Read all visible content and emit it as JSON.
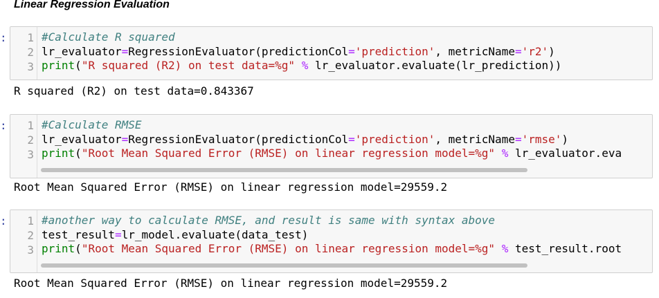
{
  "heading": "Linear Regression Evaluation",
  "prompt_label": ":",
  "cells": [
    {
      "lines": [
        [
          {
            "t": "comment",
            "v": "#Calculate R squared"
          }
        ],
        [
          {
            "t": "n",
            "v": "lr_evaluator"
          },
          {
            "t": "op",
            "v": "="
          },
          {
            "t": "n",
            "v": "RegressionEvaluator(predictionCol"
          },
          {
            "t": "op",
            "v": "="
          },
          {
            "t": "str",
            "v": "'prediction'"
          },
          {
            "t": "n",
            "v": ", metricName"
          },
          {
            "t": "op",
            "v": "="
          },
          {
            "t": "str",
            "v": "'r2'"
          },
          {
            "t": "n",
            "v": ")"
          }
        ],
        [
          {
            "t": "builtin",
            "v": "print"
          },
          {
            "t": "n",
            "v": "("
          },
          {
            "t": "str",
            "v": "\"R squared (R2) on test data=%g\""
          },
          {
            "t": "n",
            "v": " "
          },
          {
            "t": "op",
            "v": "%"
          },
          {
            "t": "n",
            "v": " lr_evaluator.evaluate(lr_prediction))"
          }
        ]
      ],
      "line_numbers": [
        "1",
        "2",
        "3"
      ],
      "output": "R squared (R2) on test data=0.843367"
    },
    {
      "lines": [
        [
          {
            "t": "comment",
            "v": "#Calculate RMSE"
          }
        ],
        [
          {
            "t": "n",
            "v": "lr_evaluator"
          },
          {
            "t": "op",
            "v": "="
          },
          {
            "t": "n",
            "v": "RegressionEvaluator(predictionCol"
          },
          {
            "t": "op",
            "v": "="
          },
          {
            "t": "str",
            "v": "'prediction'"
          },
          {
            "t": "n",
            "v": ", metricName"
          },
          {
            "t": "op",
            "v": "="
          },
          {
            "t": "str",
            "v": "'rmse'"
          },
          {
            "t": "n",
            "v": ")"
          }
        ],
        [
          {
            "t": "builtin",
            "v": "print"
          },
          {
            "t": "n",
            "v": "("
          },
          {
            "t": "str",
            "v": "\"Root Mean Squared Error (RMSE) on linear regression model=%g\""
          },
          {
            "t": "n",
            "v": " "
          },
          {
            "t": "op",
            "v": "%"
          },
          {
            "t": "n",
            "v": " lr_evaluator.eva"
          }
        ]
      ],
      "line_numbers": [
        "1",
        "2",
        "3"
      ],
      "output": "Root Mean Squared Error (RMSE) on linear regression model=29559.2"
    },
    {
      "lines": [
        [
          {
            "t": "comment",
            "v": "#another way to calculate RMSE, and result is same with syntax above"
          }
        ],
        [
          {
            "t": "n",
            "v": "test_result"
          },
          {
            "t": "op",
            "v": "="
          },
          {
            "t": "n",
            "v": "lr_model.evaluate(data_test)"
          }
        ],
        [
          {
            "t": "builtin",
            "v": "print"
          },
          {
            "t": "n",
            "v": "("
          },
          {
            "t": "str",
            "v": "\"Root Mean Squared Error (RMSE) on linear regression model=%g\""
          },
          {
            "t": "n",
            "v": " "
          },
          {
            "t": "op",
            "v": "%"
          },
          {
            "t": "n",
            "v": " test_result.root"
          }
        ]
      ],
      "line_numbers": [
        "1",
        "2",
        "3"
      ],
      "output": "Root Mean Squared Error (RMSE) on linear regression model=29559.2"
    }
  ]
}
